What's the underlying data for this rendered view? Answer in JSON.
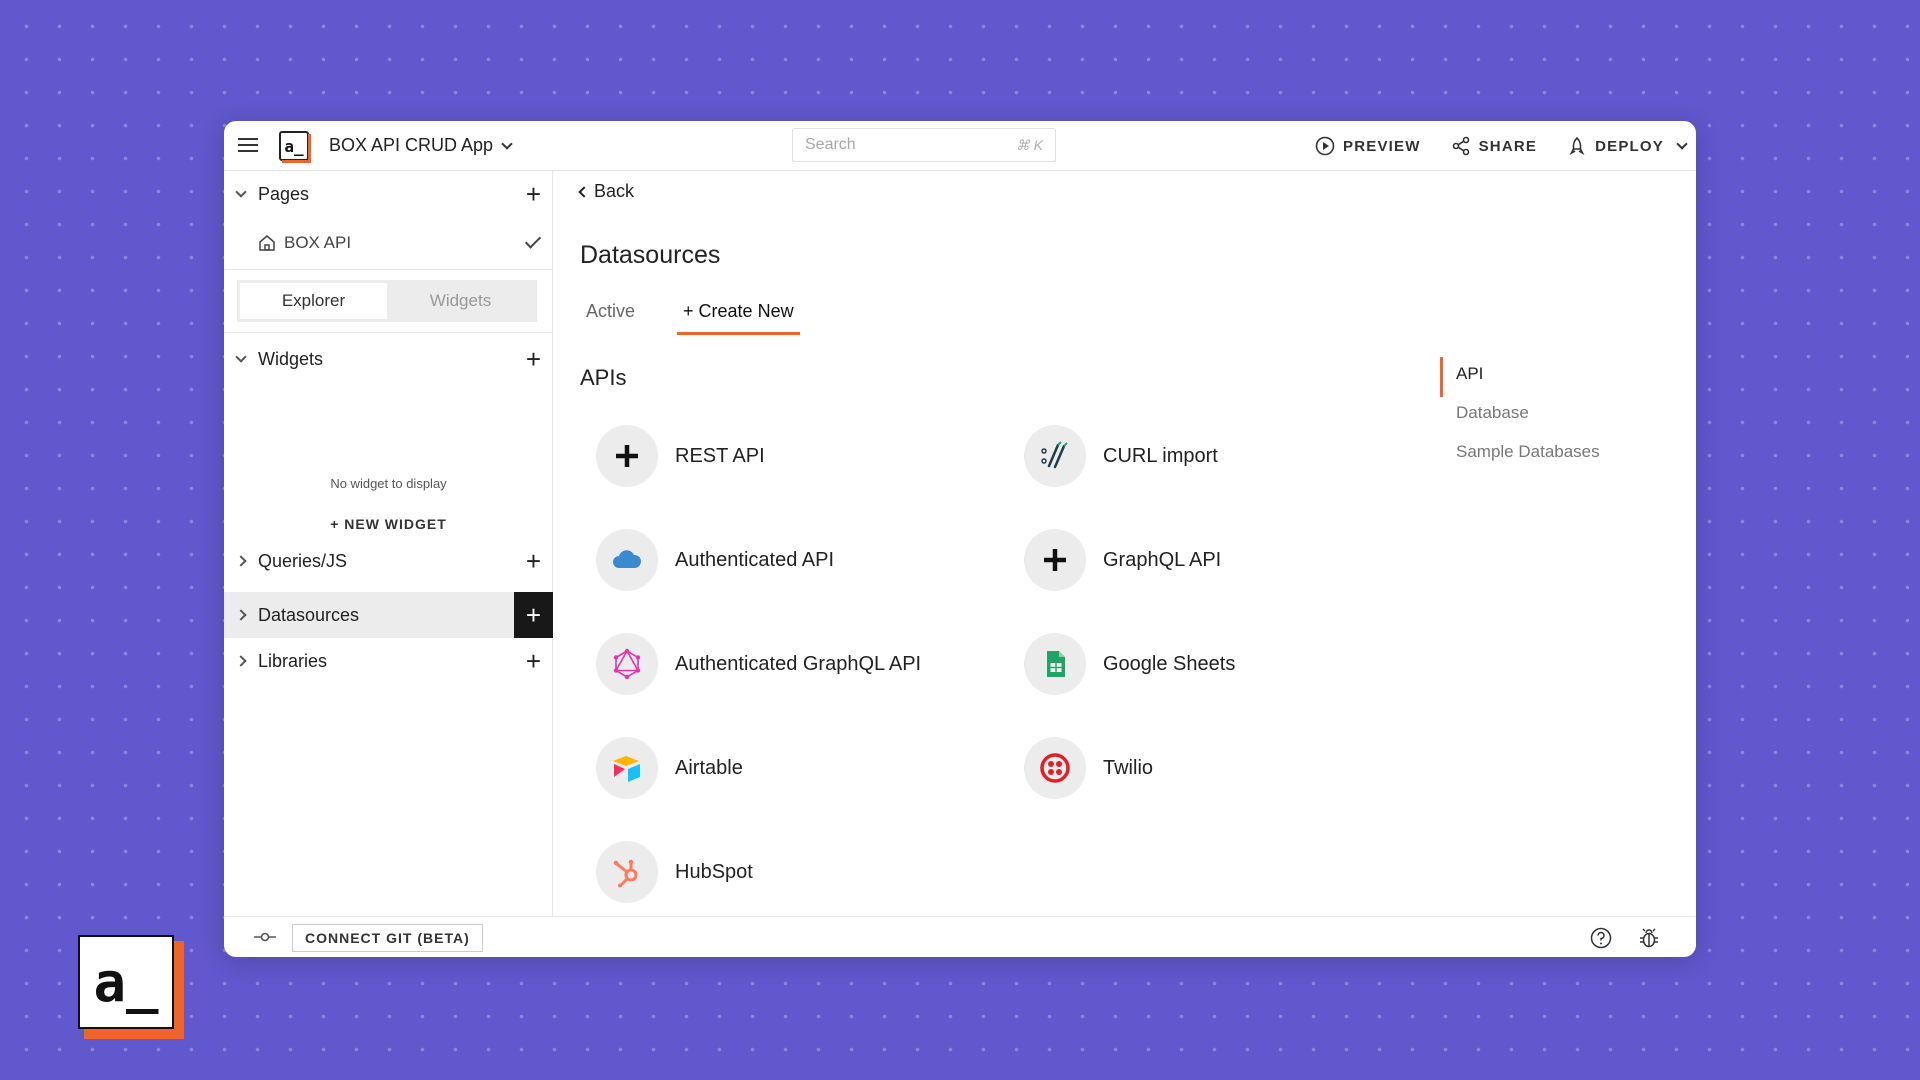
{
  "header": {
    "app_name": "BOX API CRUD App",
    "logo_text": "a_",
    "search_placeholder": "Search",
    "search_shortcut": "⌘ K",
    "preview_label": "PREVIEW",
    "share_label": "SHARE",
    "deploy_label": "DEPLOY"
  },
  "sidebar": {
    "pages_label": "Pages",
    "page_name": "BOX API",
    "tabs": [
      "Explorer",
      "Widgets"
    ],
    "widgets_label": "Widgets",
    "empty_message": "No widget to display",
    "new_widget_label": "+ NEW WIDGET",
    "queries_label": "Queries/JS",
    "datasources_label": "Datasources",
    "libraries_label": "Libraries"
  },
  "main": {
    "back_label": "Back",
    "title": "Datasources",
    "tabs": [
      "Active",
      "+ Create New"
    ],
    "section_title": "APIs",
    "datasources": [
      {
        "name": "REST API",
        "icon": "plus-icon"
      },
      {
        "name": "CURL import",
        "icon": "curl-icon"
      },
      {
        "name": "Authenticated API",
        "icon": "cloud-icon"
      },
      {
        "name": "GraphQL API",
        "icon": "plus-icon"
      },
      {
        "name": "Authenticated GraphQL API",
        "icon": "graphql-icon"
      },
      {
        "name": "Google Sheets",
        "icon": "google-sheets-icon"
      },
      {
        "name": "Airtable",
        "icon": "airtable-icon"
      },
      {
        "name": "Twilio",
        "icon": "twilio-icon"
      },
      {
        "name": "HubSpot",
        "icon": "hubspot-icon"
      }
    ],
    "right_nav": [
      "API",
      "Database",
      "Sample Databases"
    ]
  },
  "footer": {
    "connect_git_label": "CONNECT GIT (BETA)"
  },
  "colors": {
    "accent": "#f0642a",
    "background": "#6058cc"
  }
}
